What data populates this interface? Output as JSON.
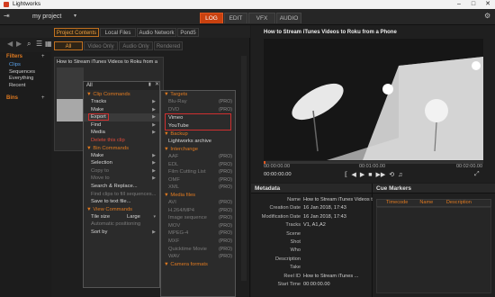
{
  "app": {
    "title": "Lightworks"
  },
  "toolbar": {
    "project_name": "my project"
  },
  "tabs": [
    "LOG",
    "EDIT",
    "VFX",
    "AUDIO"
  ],
  "browser": {
    "source_tabs": [
      "Project Contents",
      "Local Files",
      "Audio Network",
      "Pond5"
    ],
    "filter_tabs": [
      "All",
      "Video Only",
      "Audio Only",
      "Rendered"
    ]
  },
  "filters": {
    "header": "Filters",
    "items": [
      "Clips",
      "Sequences",
      "Everything",
      "Recent"
    ],
    "bins_header": "Bins"
  },
  "clip": {
    "title": "How to Stream iTunes Videos to Roku from a"
  },
  "context_menu": {
    "title": "All",
    "clip_commands_header": "Clip Commands",
    "clip_items": [
      "Tracks",
      "Make",
      "Export",
      "Find",
      "Media",
      "Delete this clip"
    ],
    "bin_commands_header": "Bin Commands",
    "bin_items": [
      "Make",
      "Selection",
      "Copy to",
      "Move to",
      "Search & Replace...",
      "Find clips to fill sequences...",
      "Save to text file..."
    ],
    "view_commands_header": "View Commands",
    "view_items": [
      "Tile size",
      "Automatic positioning",
      "Sort by"
    ],
    "tile_size_value": "Large"
  },
  "targets_menu": {
    "targets_header": "Targets",
    "targets": [
      "Blu-Ray",
      "DVD",
      "Vimeo",
      "YouTube"
    ],
    "backup_header": "Backup",
    "backup_items": [
      "Lightworks archive"
    ],
    "interchange_header": "Interchange",
    "interchange_items": [
      "AAF",
      "EDL",
      "Film Cutting List",
      "OMF",
      "XML"
    ],
    "media_header": "Media files",
    "media_items": [
      "AVI",
      "H.264/MP4",
      "Image sequence",
      "MOV",
      "MPEG-4",
      "MXF",
      "Quicktime Movie",
      "WAV"
    ],
    "camera_header": "Camera formats",
    "pro_label": "(PRO)"
  },
  "viewer": {
    "title": "How to Stream iTunes Videos to Roku from a Phone",
    "tc_left": "00:00:00.00",
    "tc_mid": "00:01:00.00",
    "tc_right": "00:02:00.00",
    "tc_current": "00:00:00.00"
  },
  "metadata": {
    "header": "Metadata",
    "rows": [
      {
        "k": "Name",
        "v": "How to Stream iTunes Videos to R"
      },
      {
        "k": "Creation Date",
        "v": "16 Jan 2018, 17:43"
      },
      {
        "k": "Modification Date",
        "v": "16 Jan 2018, 17:43"
      },
      {
        "k": "Tracks",
        "v": "V1, A1,A2"
      },
      {
        "k": "Scene",
        "v": ""
      },
      {
        "k": "Shot",
        "v": ""
      },
      {
        "k": "Who",
        "v": ""
      },
      {
        "k": "Description",
        "v": ""
      },
      {
        "k": "Take",
        "v": ""
      },
      {
        "k": "Reel ID",
        "v": "How to Stream iTunes ..."
      },
      {
        "k": "Start Time",
        "v": "00:00:00.00"
      }
    ]
  },
  "cue_markers": {
    "header": "Cue Markers",
    "columns": [
      "Timecode",
      "Name",
      "Description"
    ]
  },
  "colors": {
    "accent": "#c9410f",
    "highlight": "#e05620",
    "selection_box": "#d03030"
  }
}
